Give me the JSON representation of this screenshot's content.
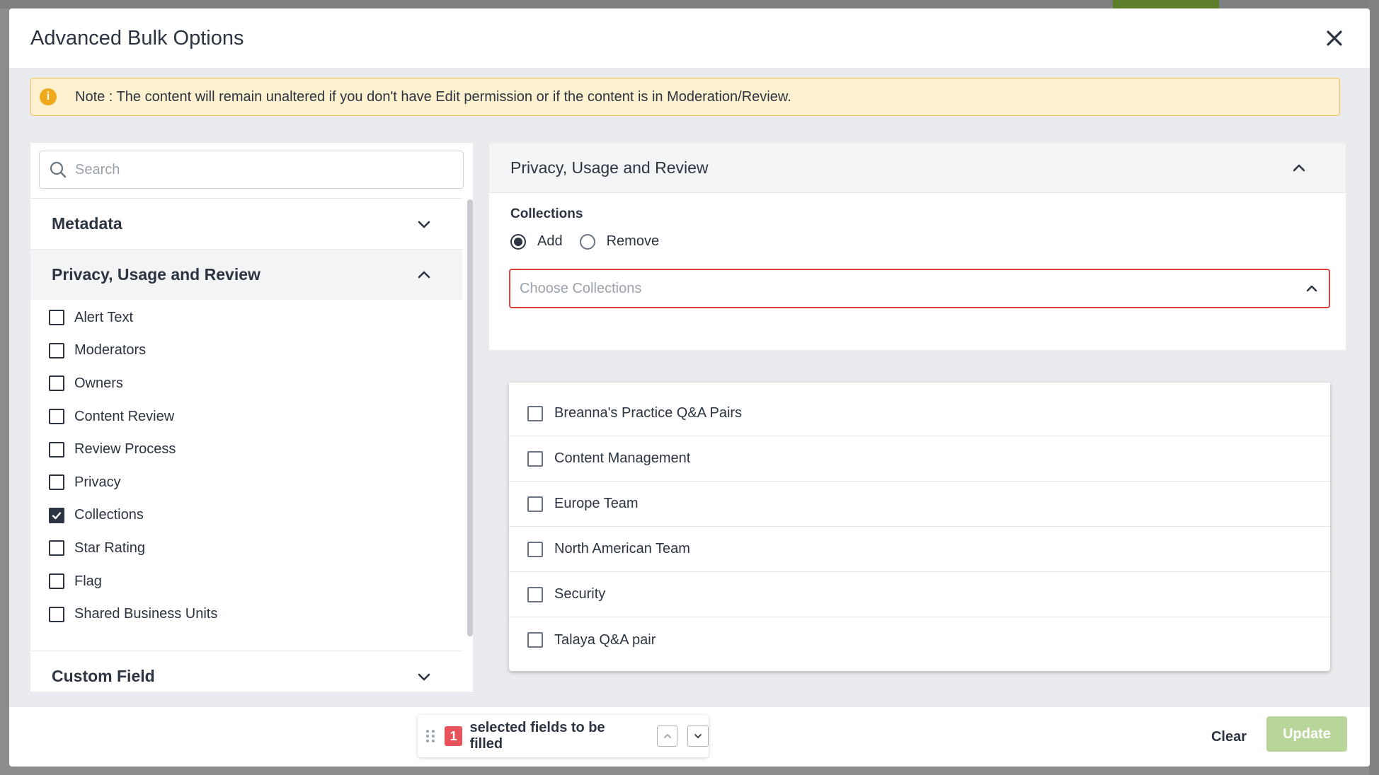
{
  "modal": {
    "title": "Advanced Bulk Options",
    "notice": "Note : The content will remain unaltered if you don't have Edit permission or if the content is in Moderation/Review."
  },
  "search": {
    "placeholder": "Search"
  },
  "sections": {
    "metadata": "Metadata",
    "privacy": "Privacy, Usage and Review",
    "custom": "Custom Field"
  },
  "fields": [
    {
      "label": "Alert Text",
      "checked": false
    },
    {
      "label": "Moderators",
      "checked": false
    },
    {
      "label": "Owners",
      "checked": false
    },
    {
      "label": "Content Review",
      "checked": false
    },
    {
      "label": "Review Process",
      "checked": false
    },
    {
      "label": "Privacy",
      "checked": false
    },
    {
      "label": "Collections",
      "checked": true
    },
    {
      "label": "Star Rating",
      "checked": false
    },
    {
      "label": "Flag",
      "checked": false
    },
    {
      "label": "Shared Business Units",
      "checked": false
    }
  ],
  "right_panel": {
    "title": "Privacy, Usage and Review",
    "collections_label": "Collections",
    "radio_add": "Add",
    "radio_remove": "Remove",
    "selected_mode": "Add",
    "select_placeholder": "Choose Collections"
  },
  "collections": [
    {
      "label": "Breanna's Practice Q&A Pairs",
      "checked": false
    },
    {
      "label": "Content Management",
      "checked": false
    },
    {
      "label": "Europe Team",
      "checked": false
    },
    {
      "label": "North American Team",
      "checked": false
    },
    {
      "label": "Security",
      "checked": false
    },
    {
      "label": "Talaya Q&A pair",
      "checked": false
    }
  ],
  "footer": {
    "selected_count": "1",
    "selected_text": "selected fields to be filled",
    "clear_label": "Clear",
    "update_label": "Update"
  },
  "colors": {
    "error_border": "#e0403c",
    "notice_bg": "#fdf1cf",
    "update_disabled": "#b9d69a",
    "count_badge": "#e8525a"
  }
}
